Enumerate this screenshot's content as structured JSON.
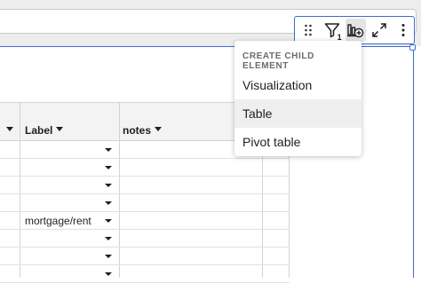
{
  "toolbar": {
    "filter_badge": "1",
    "icons": [
      "drag-handle-icon",
      "filter-icon",
      "add-child-chart-icon",
      "expand-icon",
      "more-options-icon"
    ]
  },
  "grid": {
    "headers": [
      {
        "label": ""
      },
      {
        "label": "Label"
      },
      {
        "label": "notes"
      }
    ],
    "rows": [
      {
        "label": ""
      },
      {
        "label": ""
      },
      {
        "label": ""
      },
      {
        "label": ""
      },
      {
        "label": "mortgage/rent"
      },
      {
        "label": ""
      },
      {
        "label": ""
      },
      {
        "label": ""
      }
    ]
  },
  "menu": {
    "title": "CREATE CHILD ELEMENT",
    "items": [
      {
        "label": "Visualization"
      },
      {
        "label": "Table"
      },
      {
        "label": "Pivot table"
      }
    ]
  },
  "colors": {
    "accent": "#3b6fd0",
    "header_bg": "#f3f3f3",
    "menu_hover": "#efefef"
  }
}
